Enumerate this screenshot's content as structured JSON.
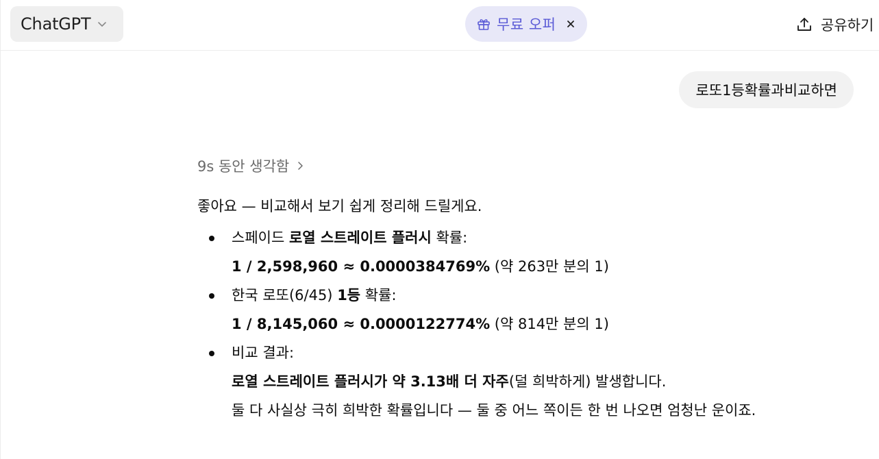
{
  "header": {
    "model_label": "ChatGPT",
    "offer_label": "무료 오퍼",
    "share_label": "공유하기"
  },
  "user_message": "로또1등확률과비교하면",
  "thinking_label": "9s 동안 생각함",
  "response": {
    "intro": "좋아요 — 비교해서 보기 쉽게 정리해 드릴게요.",
    "items": [
      {
        "l1_pre": "스페이드 ",
        "l1_bold": "로열 스트레이트 플러시",
        "l1_post": " 확률:",
        "l2_bold": "1 / 2,598,960 ≈ 0.0000384769%",
        "l2_post": " (약 263만 분의 1)"
      },
      {
        "l1_pre": "한국 로또(6/45) ",
        "l1_bold": "1등",
        "l1_post": " 확률:",
        "l2_bold": "1 / 8,145,060 ≈ 0.0000122774%",
        "l2_post": " (약 814만 분의 1)"
      }
    ],
    "compare": {
      "l1": "비교 결과:",
      "l2_bold": "로열 스트레이트 플러시가 약 3.13배 더 자주",
      "l2_post": "(덜 희박하게) 발생합니다.",
      "l3": "둘 다 사실상 극히 희박한 확률입니다 — 둘 중 어느 쪽이든 한 번 나오면 엄청난 운이죠."
    }
  },
  "colors": {
    "offer_bg": "#e8e8f8",
    "offer_accent": "#5b5bd6",
    "bubble_bg": "#f2f2f2",
    "model_btn_bg": "#efefef"
  },
  "icons": {
    "model_chevron": "chevron-down-icon",
    "offer": "gift-icon",
    "offer_close": "close-icon",
    "share": "share-upload-icon",
    "thinking": "chevron-right-icon"
  }
}
